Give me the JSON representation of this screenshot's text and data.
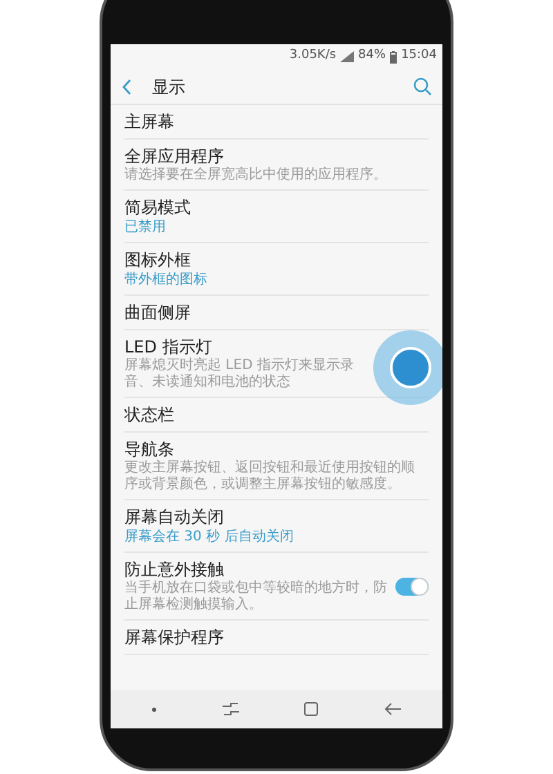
{
  "status_bar": {
    "speed": "3.05K/s",
    "battery": "84%",
    "time": "15:04"
  },
  "header": {
    "title": "显示"
  },
  "items": [
    {
      "kind": "plain",
      "title": "主屏幕"
    },
    {
      "kind": "plain",
      "title": "全屏应用程序",
      "subtitle": "请选择要在全屏宽高比中使用的应用程序。"
    },
    {
      "kind": "value",
      "title": "简易模式",
      "value": "已禁用"
    },
    {
      "kind": "value",
      "title": "图标外框",
      "value": "带外框的图标"
    },
    {
      "kind": "plain",
      "title": "曲面侧屏"
    },
    {
      "kind": "plain",
      "title": "LED 指示灯",
      "subtitle": "屏幕熄灭时亮起 LED 指示灯来显示录音、未读通知和电池的状态",
      "touched": true
    },
    {
      "kind": "plain",
      "title": "状态栏"
    },
    {
      "kind": "plain",
      "title": "导航条",
      "subtitle": "更改主屏幕按钮、返回按钮和最近使用按钮的顺序或背景颜色，或调整主屏幕按钮的敏感度。"
    },
    {
      "kind": "value",
      "title": "屏幕自动关闭",
      "value": "屏幕会在 30 秒 后自动关闭"
    },
    {
      "kind": "toggle",
      "title": "防止意外接触",
      "subtitle": "当手机放在口袋或包中等较暗的地方时，防止屏幕检测触摸输入。",
      "on": true
    },
    {
      "kind": "plain",
      "title": "屏幕保护程序"
    }
  ]
}
